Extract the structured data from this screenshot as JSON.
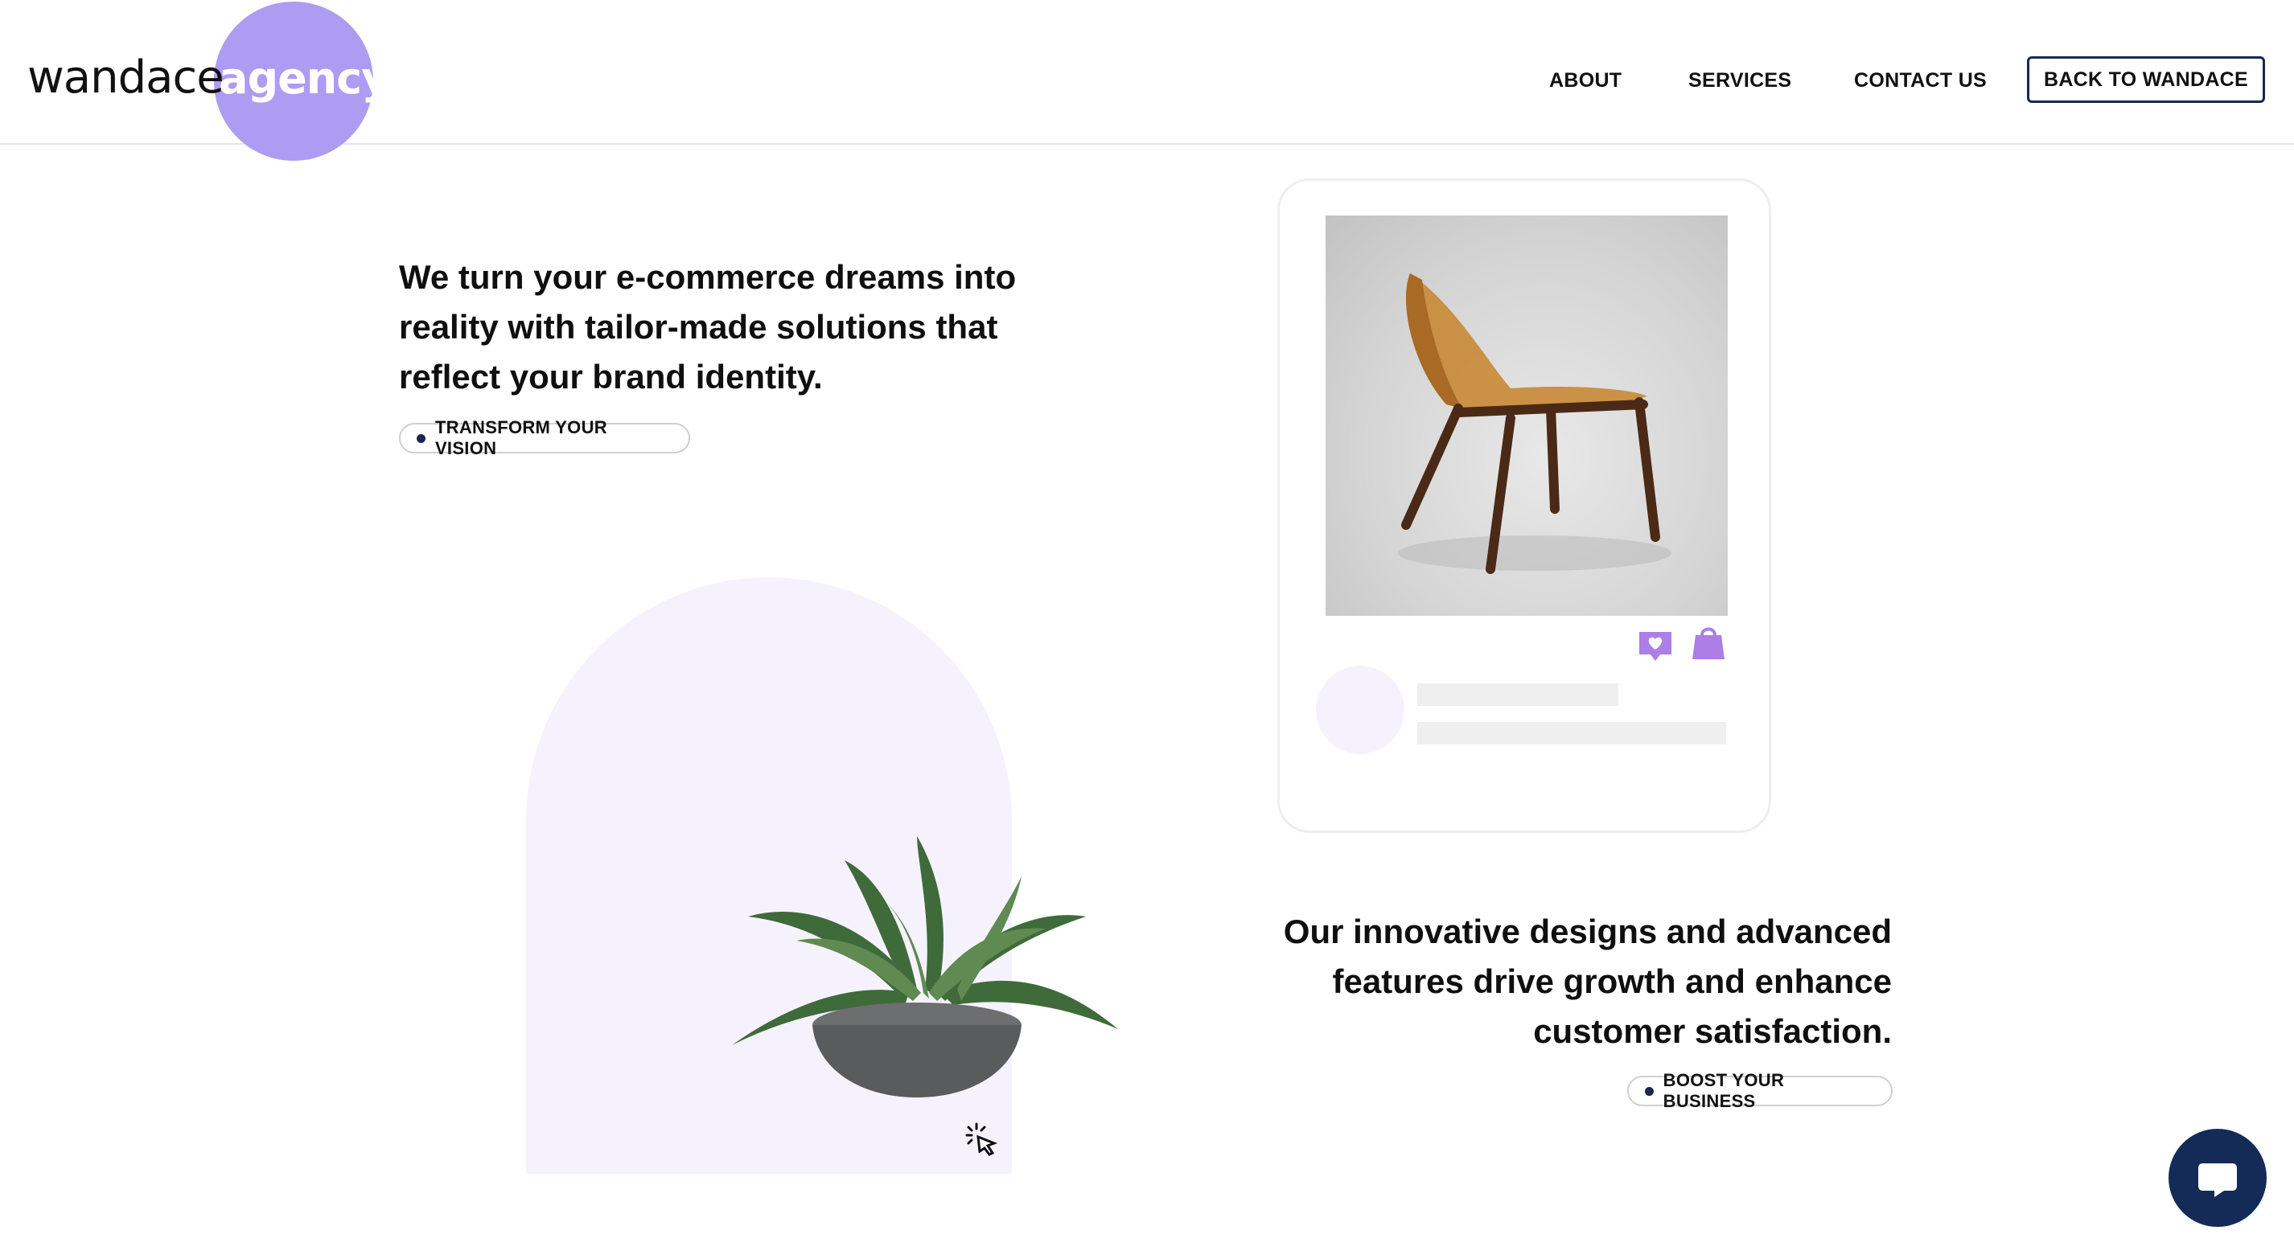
{
  "header": {
    "logo_word": "wandace",
    "logo_badge": "agency",
    "nav": [
      "ABOUT",
      "SERVICES",
      "CONTACT US"
    ],
    "cta": "BACK TO WANDACE"
  },
  "hero": {
    "headline": [
      "We turn your e-commerce dreams into",
      "reality with tailor-made solutions that",
      "reflect your brand identity."
    ],
    "tag": "TRANSFORM YOUR VISION"
  },
  "feature": {
    "headline": [
      "Our innovative designs and advanced",
      "features drive growth and enhance",
      "customer satisfaction."
    ],
    "tag": "BOOST YOUR BUSINESS"
  },
  "colors": {
    "accent": "#ac9cf2",
    "accent_dark": "#1b2750",
    "arch_bg": "#f6f2fd",
    "chat_bg": "#142b57"
  },
  "icons": [
    "heart-message-icon",
    "shopping-bag-icon",
    "cursor-click-icon",
    "chat-icon"
  ]
}
